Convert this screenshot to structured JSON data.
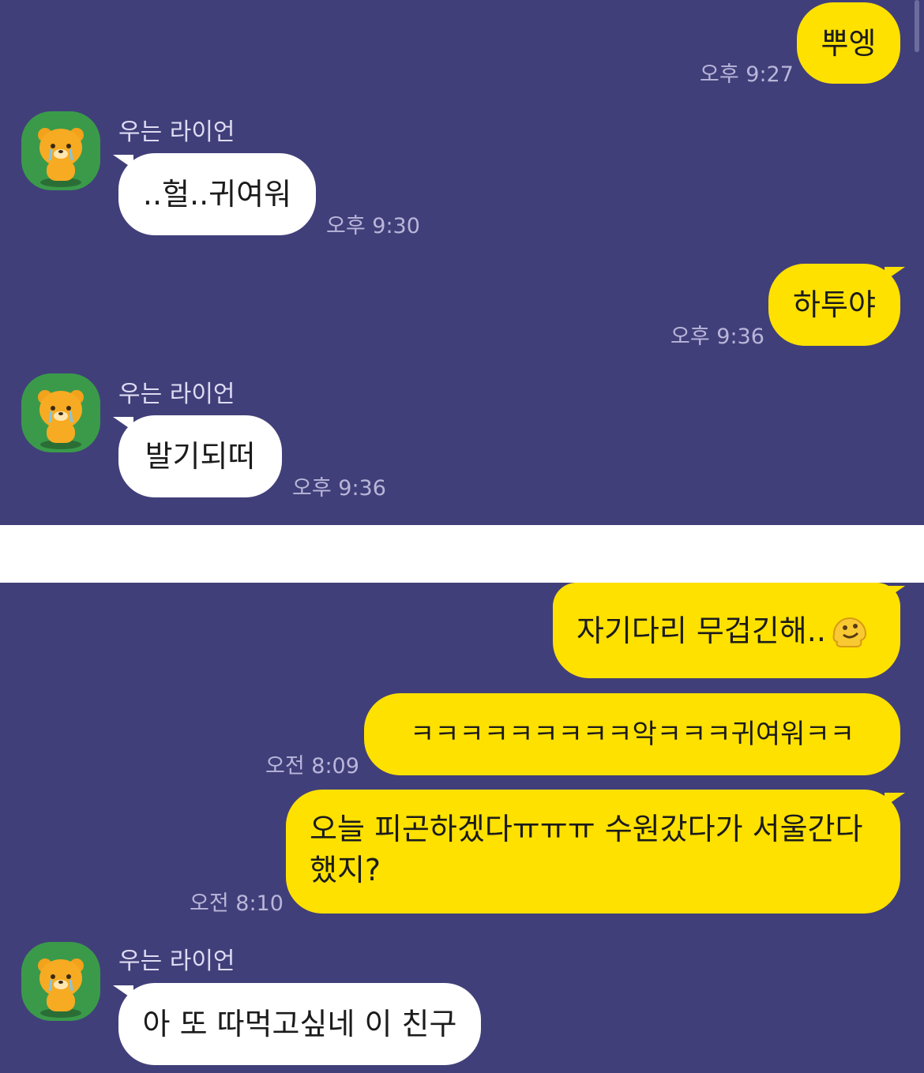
{
  "chat": {
    "partner_name": "우는 라이언",
    "panel1": {
      "m1": {
        "text": "뿌엥",
        "time": "오후 9:27"
      },
      "m2": {
        "text": "..헐..귀여워",
        "time": "오후 9:30"
      },
      "m3": {
        "text": "하투야",
        "time": "오후 9:36"
      },
      "m4": {
        "text": "발기되떠",
        "time": "오후 9:36"
      }
    },
    "panel2": {
      "m5": {
        "text": "자기다리 무겁긴해.."
      },
      "m6": {
        "text": "ㅋㅋㅋㅋㅋㅋㅋㅋㅋ악ㅋㅋㅋ귀여워ㅋㅋ",
        "time": "오전 8:09"
      },
      "m7": {
        "text": "오늘 피곤하겠다ㅠㅠㅠ 수원갔다가 서울간다 했지?",
        "time": "오전 8:10"
      },
      "m8": {
        "text": "아 또 따먹고싶네 이 친구"
      }
    }
  },
  "colors": {
    "background": "#413f79",
    "my_bubble": "#ffe100",
    "their_bubble": "#ffffff",
    "timestamp": "#b9b6da"
  },
  "icons": {
    "avatar": "crying-lion-avatar-icon",
    "emoji": "melting-face-emoji-icon"
  }
}
